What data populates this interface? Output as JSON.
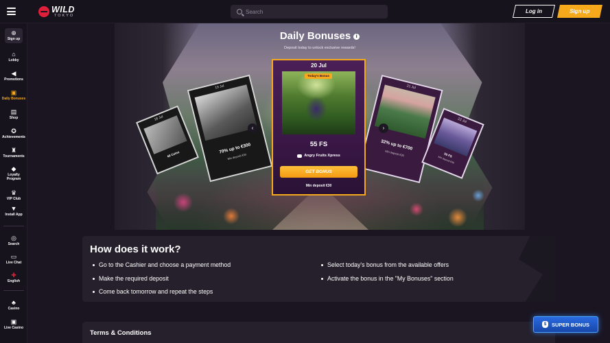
{
  "header": {
    "logo_main": "WILD",
    "logo_sub": "TOKYO",
    "search_placeholder": "Search",
    "login_label": "Log in",
    "signup_label": "Sign up"
  },
  "sidebar": {
    "signup_label": "Sign up",
    "items": [
      {
        "label": "Lobby",
        "icon": "home-icon"
      },
      {
        "label": "Promotions",
        "icon": "megaphone-icon"
      },
      {
        "label": "Daily Bonuses",
        "icon": "gift-icon",
        "active": true
      },
      {
        "label": "Shop",
        "icon": "shop-icon"
      },
      {
        "label": "Achievements",
        "icon": "achievements-icon"
      },
      {
        "label": "Tournaments",
        "icon": "trophy-icon"
      },
      {
        "label": "Loyalty Program",
        "icon": "diamond-icon"
      },
      {
        "label": "VIP Club",
        "icon": "crown-icon"
      },
      {
        "label": "Install App",
        "icon": "download-icon"
      },
      {
        "label": "Search",
        "icon": "search-icon"
      },
      {
        "label": "Live Chat",
        "icon": "chat-icon"
      },
      {
        "label": "English",
        "icon": "uk-flag-icon"
      },
      {
        "label": "Casino",
        "icon": "casino-icon"
      },
      {
        "label": "Live Casino",
        "icon": "live-casino-icon"
      }
    ]
  },
  "hero": {
    "title": "Daily Bonuses",
    "subtitle": "Deposit today to unlock exclusive rewards!"
  },
  "cards": {
    "far_left": {
      "date": "18 Jul",
      "value": "49 Coins",
      "min": ""
    },
    "left": {
      "date": "19 Jul",
      "value": "70% up to €300",
      "min": "Min deposit €30"
    },
    "main": {
      "date": "20 Jul",
      "badge": "Today's Bonus",
      "value": "55 FS",
      "game": "Angry Fruits Xpress",
      "button": "GET BONUS",
      "min": "Min deposit €30"
    },
    "right": {
      "date": "21 Jul",
      "value": "32% up to €700",
      "min": "Min deposit €30"
    },
    "far_right": {
      "date": "22 Jul",
      "value": "55 FS",
      "min": "Min deposit €30"
    }
  },
  "how": {
    "title": "How does it work?",
    "steps": [
      "Go to the Cashier and choose a payment method",
      "Select today's bonus from the available offers",
      "Make the required deposit",
      "Activate the bonus in the \"My Bonuses\" section",
      "Come back tomorrow and repeat the steps"
    ]
  },
  "terms": {
    "title": "Terms & Conditions"
  },
  "super_bonus": {
    "label": "SUPER BONUS"
  },
  "colors": {
    "accent": "#f7a91c",
    "background": "#1a1521",
    "panel": "#25202b",
    "super_bonus": "#1f5ad0"
  }
}
